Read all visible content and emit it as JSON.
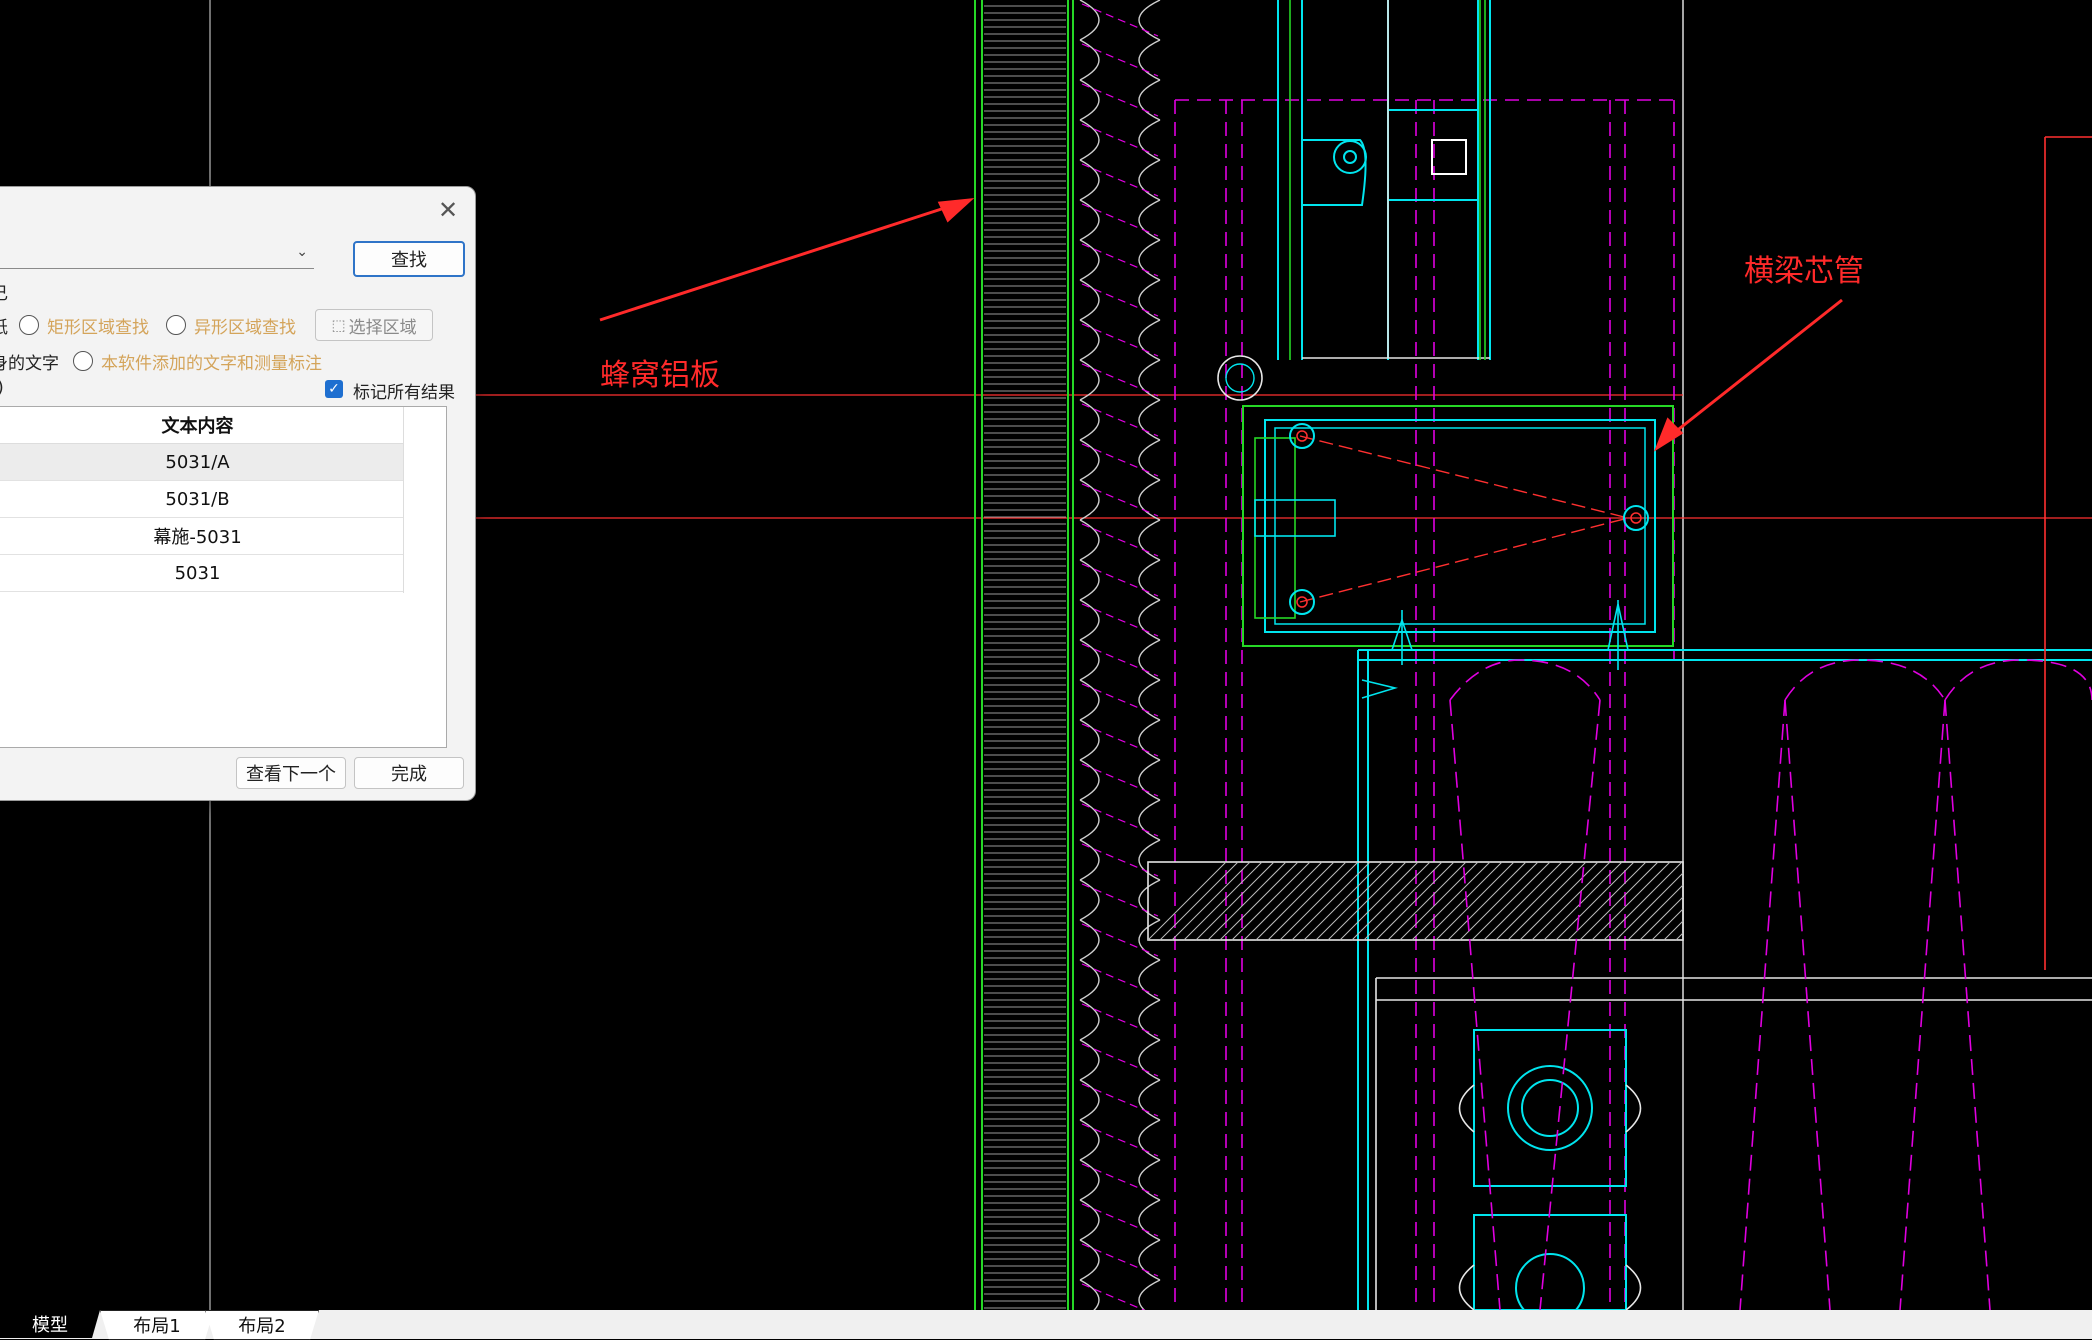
{
  "annotations": {
    "left_label": "蜂窝铝板",
    "right_label": "横梁芯管"
  },
  "dialog": {
    "close_glyph": "✕",
    "search_button": "查找",
    "row1_partial": "己",
    "row2": {
      "prefix": "纸",
      "rect_search": "矩形区域查找",
      "shape_search": "异形区域查找",
      "select_area": "选择区域"
    },
    "row3": {
      "prefix": "身的文字",
      "added_text": "本软件添加的文字和测量标注"
    },
    "row4": {
      "prefix": "-)",
      "mark_all": "标记所有结果"
    },
    "table": {
      "header": "文本内容",
      "rows": [
        "5031/A",
        "5031/B",
        "幕施-5031",
        "5031"
      ]
    },
    "next_button": "查看下一个",
    "done_button": "完成"
  },
  "tabs": [
    "模型",
    "布局1",
    "布局2"
  ],
  "colors": {
    "cyan": "#00e5ee",
    "green": "#26d826",
    "magenta": "#e000e0",
    "red": "#ff2a2a",
    "white": "#e6e6e6"
  }
}
